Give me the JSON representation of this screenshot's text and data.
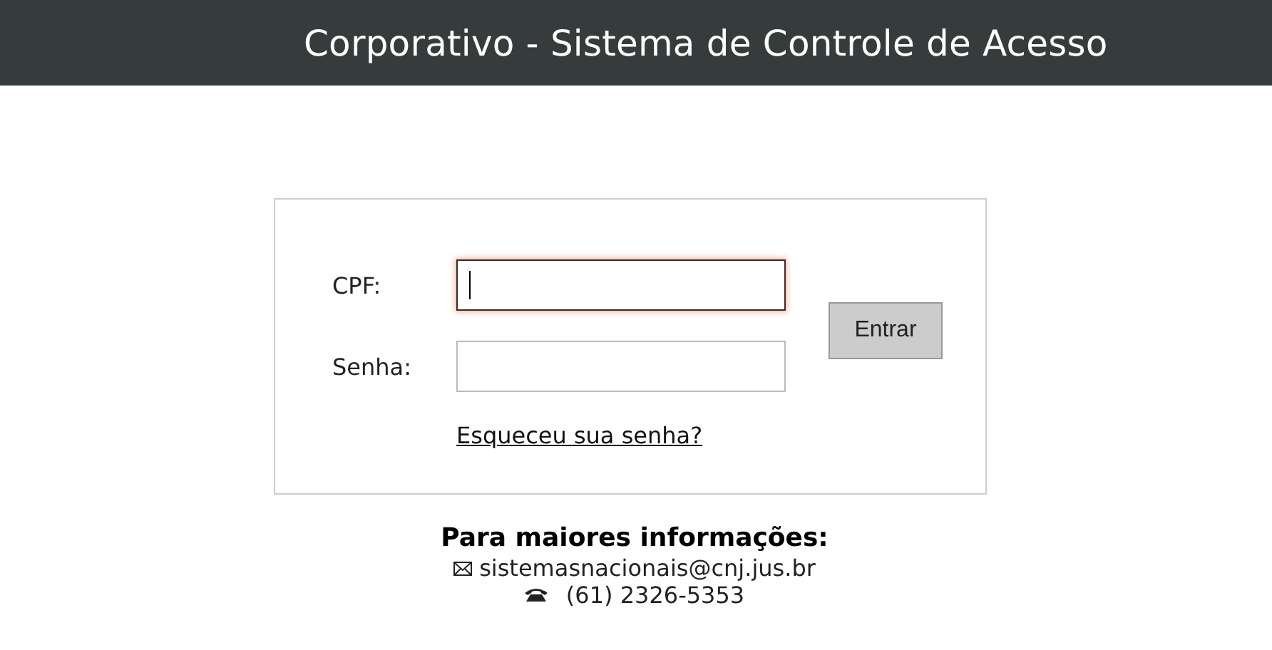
{
  "header": {
    "title": "Corporativo - Sistema de Controle de Acesso"
  },
  "login": {
    "fields": [
      {
        "label": "CPF:",
        "focused": true
      },
      {
        "label": "Senha:",
        "focused": false
      }
    ],
    "submit": "Entrar",
    "forgot_link": "Esqueceu sua senha?"
  },
  "contact": {
    "heading": "Para maiores informações:",
    "email": "sistemasnacionais@cnj.jus.br",
    "phone": "(61) 2326-5353"
  }
}
